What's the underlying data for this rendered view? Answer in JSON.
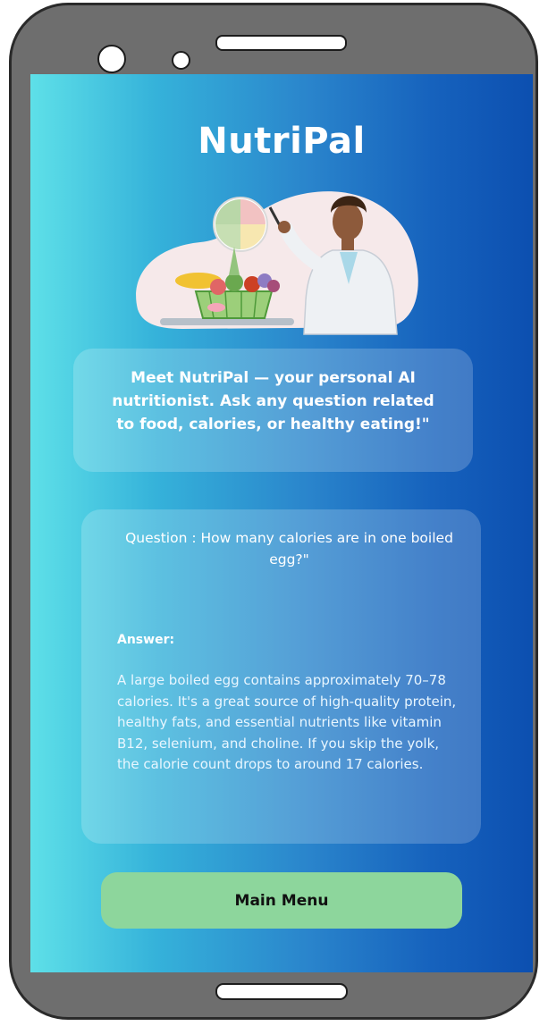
{
  "app": {
    "title": "NutriPal"
  },
  "intro": {
    "text": "Meet NutriPal — your personal AI nutritionist. Ask any question related to food, calories, or healthy eating!\""
  },
  "qa": {
    "question": "Question : How many calories are in one boiled egg?\"",
    "answer_label": "Answer:",
    "answer_text": "A large boiled egg contains approximately 70–78 calories. It's a great source of high-quality protein, healthy fats, and essential nutrients like vitamin B12, selenium, and choline. If you skip the yolk, the calorie count drops to around 17 calories."
  },
  "actions": {
    "main_menu_label": "Main Menu"
  },
  "icons": {
    "illustration": "nutritionist-illustration"
  },
  "colors": {
    "gradient_start": "#5ee0e8",
    "gradient_end": "#0c4fb0",
    "button": "#8dd69c",
    "phone_frame": "#6e6e6e"
  }
}
